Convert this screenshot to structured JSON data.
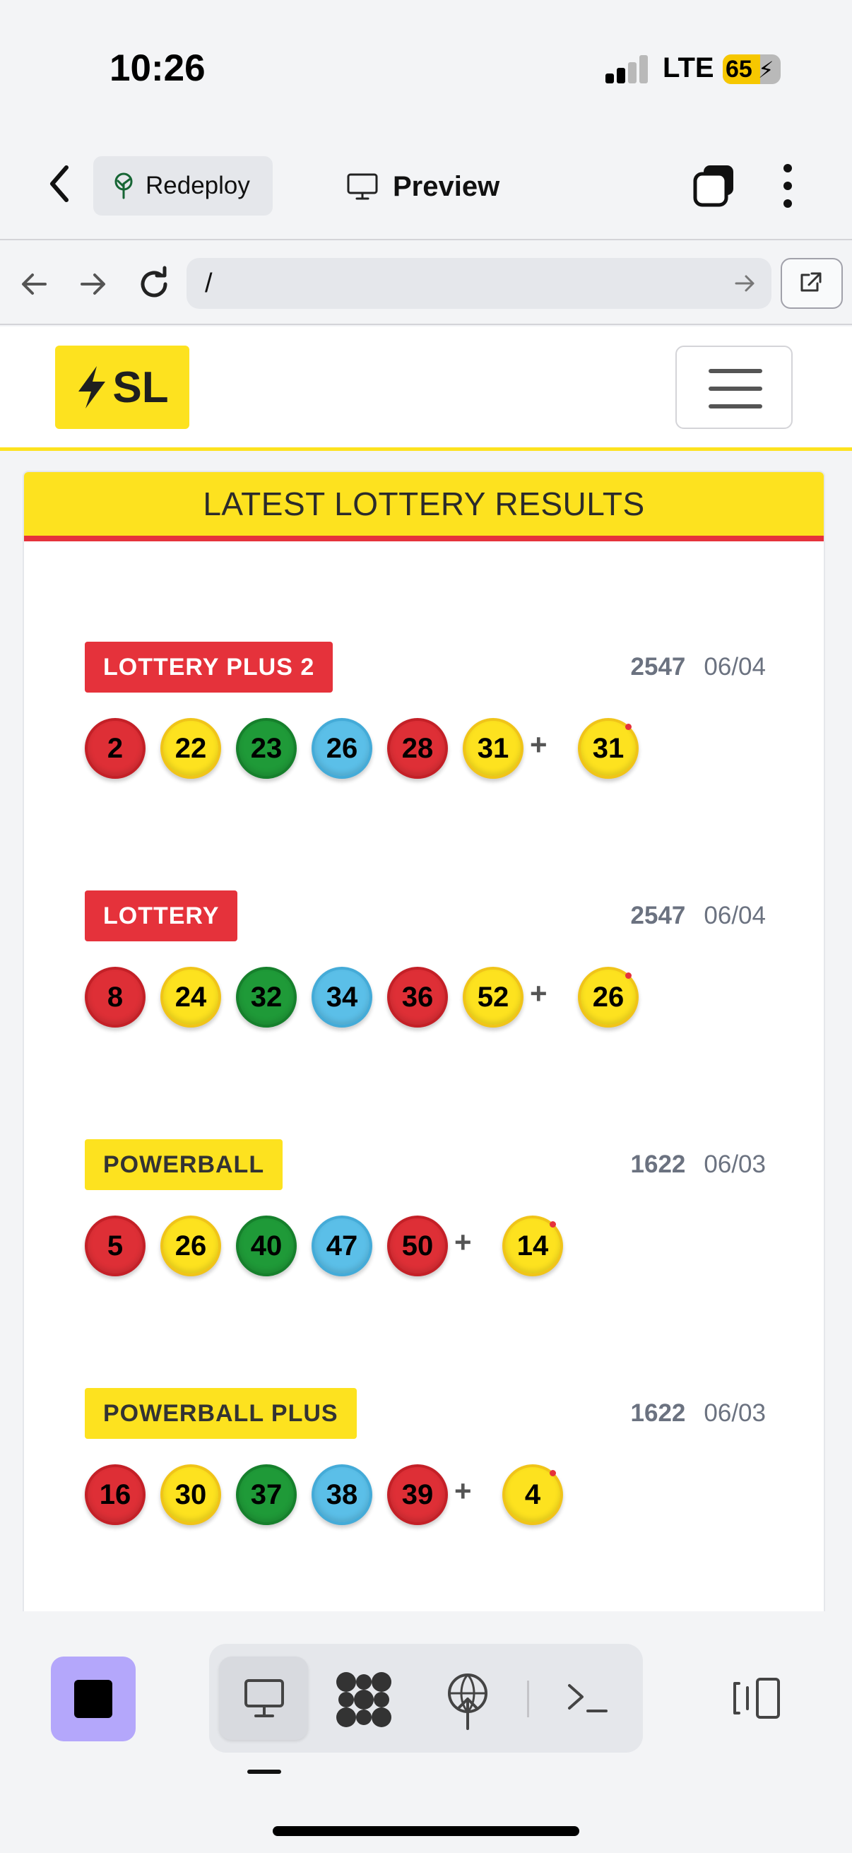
{
  "status_bar": {
    "time": "10:26",
    "network": "LTE",
    "battery": "65",
    "battery_level_percent": 65
  },
  "app_bar": {
    "redeploy_label": "Redeploy",
    "preview_label": "Preview"
  },
  "browser": {
    "url": "/"
  },
  "site": {
    "logo_text": "SL",
    "results_title": "LATEST LOTTERY RESULTS",
    "colors": {
      "brand_yellow": "#fde21f",
      "brand_red": "#e5323b",
      "ball_red": "#de2f36",
      "ball_yellow": "#fde21f",
      "ball_green": "#1f9a38",
      "ball_blue": "#5bbfe8"
    },
    "games": [
      {
        "name": "LOTTERY PLUS 2",
        "badge_color": "red",
        "draw": "2547",
        "date": "06/04",
        "balls": [
          {
            "n": "2",
            "color": "red"
          },
          {
            "n": "22",
            "color": "yellow"
          },
          {
            "n": "23",
            "color": "green"
          },
          {
            "n": "26",
            "color": "blue"
          },
          {
            "n": "28",
            "color": "red"
          },
          {
            "n": "31",
            "color": "yellow"
          }
        ],
        "plus": "+",
        "bonus": {
          "n": "31",
          "color": "yellow"
        }
      },
      {
        "name": "LOTTERY",
        "badge_color": "red",
        "draw": "2547",
        "date": "06/04",
        "balls": [
          {
            "n": "8",
            "color": "red"
          },
          {
            "n": "24",
            "color": "yellow"
          },
          {
            "n": "32",
            "color": "green"
          },
          {
            "n": "34",
            "color": "blue"
          },
          {
            "n": "36",
            "color": "red"
          },
          {
            "n": "52",
            "color": "yellow"
          }
        ],
        "plus": "+",
        "bonus": {
          "n": "26",
          "color": "yellow"
        }
      },
      {
        "name": "POWERBALL",
        "badge_color": "yellow",
        "draw": "1622",
        "date": "06/03",
        "balls": [
          {
            "n": "5",
            "color": "red"
          },
          {
            "n": "26",
            "color": "yellow"
          },
          {
            "n": "40",
            "color": "green"
          },
          {
            "n": "47",
            "color": "blue"
          },
          {
            "n": "50",
            "color": "red"
          }
        ],
        "plus": "+",
        "bonus": {
          "n": "14",
          "color": "yellow"
        }
      },
      {
        "name": "POWERBALL PLUS",
        "badge_color": "yellow",
        "draw": "1622",
        "date": "06/03",
        "balls": [
          {
            "n": "16",
            "color": "red"
          },
          {
            "n": "30",
            "color": "yellow"
          },
          {
            "n": "37",
            "color": "green"
          },
          {
            "n": "38",
            "color": "blue"
          },
          {
            "n": "39",
            "color": "red"
          }
        ],
        "plus": "+",
        "bonus": {
          "n": "4",
          "color": "yellow"
        }
      }
    ]
  },
  "bottom_bar": {
    "stop_button_color": "#b4a7fb",
    "icons": [
      "desktop-icon",
      "workflow-icon",
      "deploy-icon",
      "shell-icon",
      "panel-toggle-icon"
    ]
  }
}
